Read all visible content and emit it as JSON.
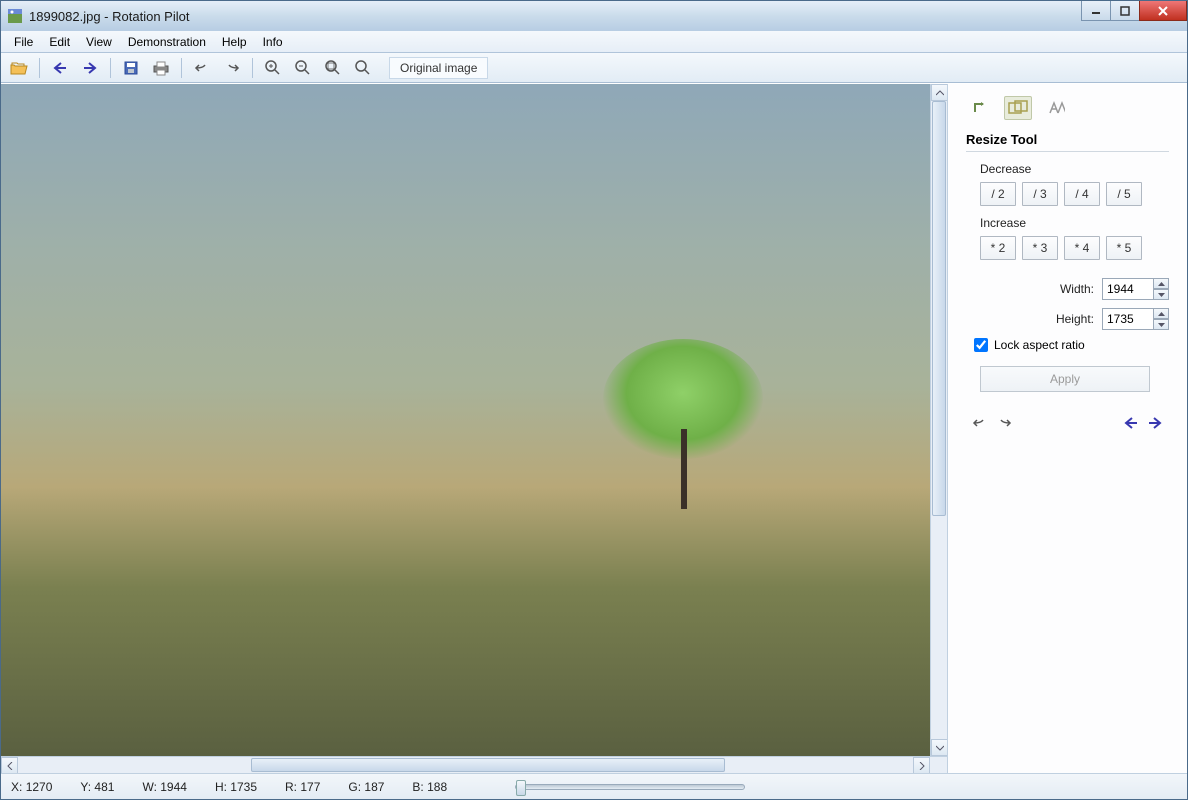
{
  "window": {
    "title": "1899082.jpg - Rotation Pilot"
  },
  "menubar": [
    "File",
    "Edit",
    "View",
    "Demonstration",
    "Help",
    "Info"
  ],
  "toolbar": {
    "zoom_label": "Original image"
  },
  "sidepanel": {
    "title": "Resize Tool",
    "decrease_label": "Decrease",
    "decrease_buttons": [
      "/ 2",
      "/ 3",
      "/ 4",
      "/ 5"
    ],
    "increase_label": "Increase",
    "increase_buttons": [
      "* 2",
      "* 3",
      "* 4",
      "* 5"
    ],
    "width_label": "Width:",
    "width_value": "1944",
    "height_label": "Height:",
    "height_value": "1735",
    "lock_label": "Lock aspect ratio",
    "lock_checked": true,
    "apply_label": "Apply"
  },
  "statusbar": {
    "x_label": "X:",
    "x_value": "1270",
    "y_label": "Y:",
    "y_value": "481",
    "w_label": "W:",
    "w_value": "1944",
    "h_label": "H:",
    "h_value": "1735",
    "r_label": "R:",
    "r_value": "177",
    "g_label": "G:",
    "g_value": "187",
    "b_label": "B:",
    "b_value": "188"
  }
}
